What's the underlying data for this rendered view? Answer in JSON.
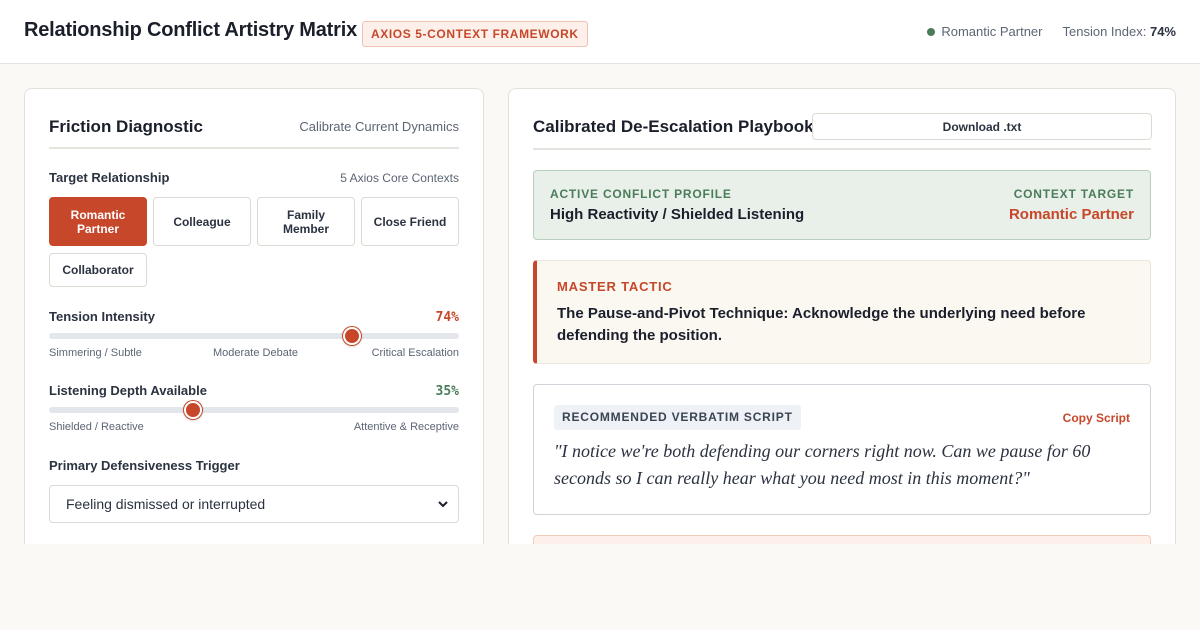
{
  "header": {
    "title": "Relationship Conflict Artistry Matrix",
    "badge": "AXIOS 5-CONTEXT FRAMEWORK",
    "status_label": "Romantic Partner",
    "tension_label": "Tension Index:",
    "tension_value": "74%",
    "status_color": "#4a7c59"
  },
  "left_panel": {
    "title": "Friction Diagnostic",
    "subtitle": "Calibrate Current Dynamics",
    "relationship": {
      "label": "Target Relationship",
      "aside": "5 Axios Core Contexts",
      "options": [
        {
          "label": "Romantic Partner",
          "active": true
        },
        {
          "label": "Colleague",
          "active": false
        },
        {
          "label": "Family Member",
          "active": false
        },
        {
          "label": "Close Friend",
          "active": false
        },
        {
          "label": "Collaborator",
          "active": false
        }
      ]
    },
    "tension": {
      "label": "Tension Intensity",
      "value_text": "74%",
      "value": 74,
      "color": "#c7472a",
      "ticks": [
        "Simmering / Subtle",
        "Moderate Debate",
        "Critical Escalation"
      ]
    },
    "listening": {
      "label": "Listening Depth Available",
      "value_text": "35%",
      "value": 35,
      "color": "#4a7c59",
      "ticks": [
        "Shielded / Reactive",
        "Attentive & Receptive"
      ]
    },
    "trigger": {
      "label": "Primary Defensiveness Trigger",
      "selected": "Feeling dismissed or interrupted"
    }
  },
  "right_panel": {
    "title": "Calibrated De-Escalation Playbook",
    "download_label": "Download .txt",
    "profile": {
      "label": "ACTIVE CONFLICT PROFILE",
      "value": "High Reactivity / Shielded Listening",
      "target_label": "CONTEXT TARGET",
      "target_value": "Romantic Partner"
    },
    "tactic": {
      "label": "MASTER TACTIC",
      "text": "The Pause-and-Pivot Technique: Acknowledge the underlying need before defending the position."
    },
    "script": {
      "label": "RECOMMENDED VERBATIM SCRIPT",
      "copy_label": "Copy Script",
      "text": "\"I notice we're both defending our corners right now. Can we pause for 60 seconds so I can really hear what you need most in this moment?\""
    }
  },
  "colors": {
    "accent": "#c7472a",
    "green": "#4a7c59",
    "background": "#fbf9f5"
  }
}
